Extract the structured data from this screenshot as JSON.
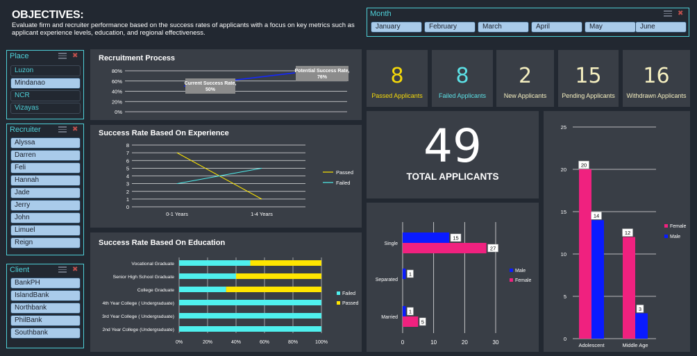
{
  "header": {
    "title": "OBJECTIVES:",
    "description": "Evaluate firm and recruiter performance based on the success rates of applicants with a focus on key metrics such as applicant experience levels, education, and regional effectiveness."
  },
  "slicers": {
    "month": {
      "label": "Month",
      "items": [
        "January",
        "February",
        "March",
        "April",
        "May",
        "June"
      ]
    },
    "place": {
      "label": "Place",
      "items": [
        "Luzon",
        "Mindanao",
        "NCR",
        "Vizayas"
      ],
      "selected": [
        "Mindanao"
      ]
    },
    "recruiter": {
      "label": "Recruiter",
      "items": [
        "Alyssa",
        "Darren",
        "Feli",
        "Hannah",
        "Jade",
        "Jerry",
        "John",
        "Limuel",
        "Reign"
      ]
    },
    "client": {
      "label": "Client",
      "items": [
        "BankPH",
        "IslandBank",
        "Northbank",
        "PhilBank",
        "Southbank"
      ]
    }
  },
  "kpis": [
    {
      "value": "8",
      "label": "Passed Applicants",
      "color": "#f5d90a"
    },
    {
      "value": "8",
      "label": "Failed Applicants",
      "color": "#5ce1e6"
    },
    {
      "value": "2",
      "label": "New Applicants",
      "color": "#f5efc0"
    },
    {
      "value": "15",
      "label": "Pending Applicants",
      "color": "#f5efc0"
    },
    {
      "value": "16",
      "label": "Withdrawn Applicants",
      "color": "#f5efc0"
    }
  ],
  "total": {
    "value": "49",
    "label": "TOTAL APPLICANTS"
  },
  "colors": {
    "passed": "#ffe600",
    "failed": "#4ff0ee",
    "male": "#0a1bff",
    "female": "#f0217f",
    "accent": "#4fd1d9"
  },
  "chart_data": [
    {
      "id": "recruitment",
      "type": "line",
      "title": "Recruitment Process",
      "yticks": [
        "0%",
        "20%",
        "40%",
        "60%",
        "80%"
      ],
      "ylim": [
        0,
        80
      ],
      "points": [
        {
          "label": "Current Success Rate,\n50%",
          "value": 50
        },
        {
          "label": "Potential Success Rate,\n76%",
          "value": 76
        }
      ]
    },
    {
      "id": "experience",
      "type": "line",
      "title": "Success Rate Based On Experience",
      "categories": [
        "0-1 Years",
        "1-4 Years"
      ],
      "ylim": [
        0,
        8
      ],
      "yticks": [
        "0",
        "1",
        "2",
        "3",
        "4",
        "5",
        "6",
        "7",
        "8"
      ],
      "series": [
        {
          "name": "Passed",
          "values": [
            7,
            1
          ]
        },
        {
          "name": "Failed",
          "values": [
            3,
            5
          ]
        }
      ],
      "legend": "right"
    },
    {
      "id": "education",
      "type": "bar",
      "orientation": "horizontal-stacked-100",
      "title": "Success Rate Based On Education",
      "categories": [
        "Vocational Graduate",
        "Senior High School Graduate",
        "College Graduate",
        "4th Year College ( Undergraduate)",
        "3rd Year College ( Undergraduate)",
        "2nd Year College (Undergraduate)"
      ],
      "xticks": [
        "0%",
        "20%",
        "40%",
        "60%",
        "80%",
        "100%"
      ],
      "series": [
        {
          "name": "Failed",
          "values": [
            50,
            40,
            33,
            100,
            100,
            100
          ]
        },
        {
          "name": "Passed",
          "values": [
            50,
            60,
            67,
            0,
            0,
            0
          ]
        }
      ],
      "legend": "right"
    },
    {
      "id": "civil",
      "type": "bar",
      "orientation": "horizontal",
      "categories": [
        "Single",
        "Separated",
        "Married"
      ],
      "xticks": [
        "0",
        "10",
        "20",
        "30"
      ],
      "xlim": [
        0,
        30
      ],
      "series": [
        {
          "name": "Male",
          "values": [
            15,
            1,
            1
          ],
          "labels": [
            "15",
            "1",
            "1"
          ]
        },
        {
          "name": "Female",
          "values": [
            27,
            0,
            5
          ],
          "labels": [
            "27",
            "",
            "5"
          ]
        }
      ],
      "legend": "right"
    },
    {
      "id": "age",
      "type": "bar",
      "orientation": "vertical",
      "categories": [
        "Adolescent",
        "Middle Age"
      ],
      "yticks": [
        "0",
        "5",
        "10",
        "15",
        "20",
        "25"
      ],
      "ylim": [
        0,
        25
      ],
      "series": [
        {
          "name": "Female",
          "values": [
            20,
            12
          ],
          "labels": [
            "20",
            "12"
          ]
        },
        {
          "name": "Male",
          "values": [
            14,
            3
          ],
          "labels": [
            "14",
            "3"
          ]
        }
      ],
      "legend": "right"
    }
  ]
}
